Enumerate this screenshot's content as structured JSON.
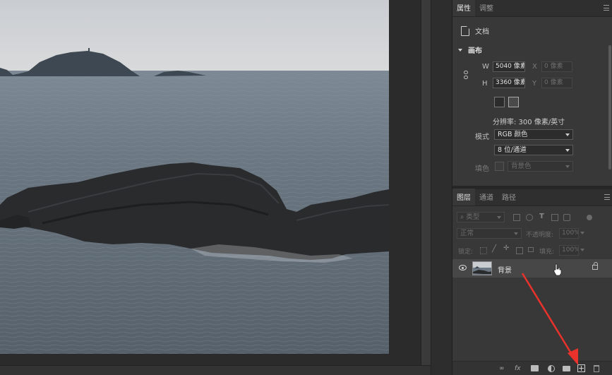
{
  "properties_panel": {
    "tabs": [
      {
        "label": "属性",
        "active": true
      },
      {
        "label": "调整",
        "active": false
      }
    ],
    "doc_label": "文档",
    "canvas_section": {
      "title": "画布",
      "w_label": "W",
      "w_value": "5040 像素",
      "h_label": "H",
      "h_value": "3360 像素",
      "x_label": "X",
      "x_placeholder": "0 像素",
      "y_label": "Y",
      "y_placeholder": "0 像素",
      "resolution": "分辨率: 300 像素/英寸",
      "mode_label": "模式",
      "mode_value": "RGB 颜色",
      "depth_value": "8 位/通道",
      "fill_label": "填色",
      "fill_value": "背景色"
    }
  },
  "layers_panel": {
    "tabs": [
      {
        "label": "图层",
        "active": true
      },
      {
        "label": "通道",
        "active": false
      },
      {
        "label": "路径",
        "active": false
      }
    ],
    "filter_type": "类型",
    "blend_mode": "正常",
    "opacity_label": "不透明度:",
    "opacity_value": "100%",
    "lock_label": "锁定:",
    "fill_label": "填充:",
    "fill_value": "100%",
    "layers": [
      {
        "name": "背景",
        "visible": true,
        "locked": true
      }
    ],
    "bottom_icons": [
      "link-icon",
      "fx-icon",
      "mask-icon",
      "adjustment-icon",
      "folder-icon",
      "new-layer-icon",
      "trash-icon"
    ],
    "fx_text": "fx"
  },
  "annotation": {
    "arrow_color": "#e8322b"
  }
}
